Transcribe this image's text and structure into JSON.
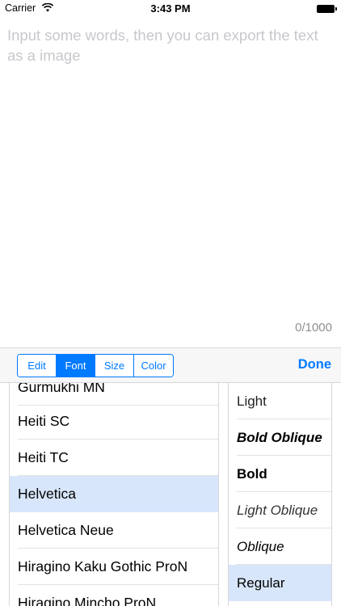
{
  "status_bar": {
    "carrier": "Carrier",
    "time": "3:43 PM",
    "wifi_icon": "wifi-icon",
    "battery_icon": "battery-icon"
  },
  "editor": {
    "placeholder": "Input some words, then you can export the text as a image",
    "counter": "0/1000"
  },
  "toolbar": {
    "tabs": [
      {
        "label": "Edit"
      },
      {
        "label": "Font"
      },
      {
        "label": "Size"
      },
      {
        "label": "Color"
      }
    ],
    "active_tab": "Font",
    "done_label": "Done",
    "accent_color": "#007aff"
  },
  "font_list": {
    "items": [
      {
        "label": "Gurmukhi MN"
      },
      {
        "label": "Heiti SC"
      },
      {
        "label": "Heiti TC"
      },
      {
        "label": "Helvetica"
      },
      {
        "label": "Helvetica Neue"
      },
      {
        "label": "Hiragino Kaku Gothic ProN"
      },
      {
        "label": "Hiragino Mincho ProN"
      }
    ],
    "selected": "Helvetica"
  },
  "style_list": {
    "items": [
      {
        "label": "Light"
      },
      {
        "label": "Bold Oblique"
      },
      {
        "label": "Bold"
      },
      {
        "label": "Light Oblique"
      },
      {
        "label": "Oblique"
      },
      {
        "label": "Regular"
      }
    ],
    "selected": "Regular"
  }
}
